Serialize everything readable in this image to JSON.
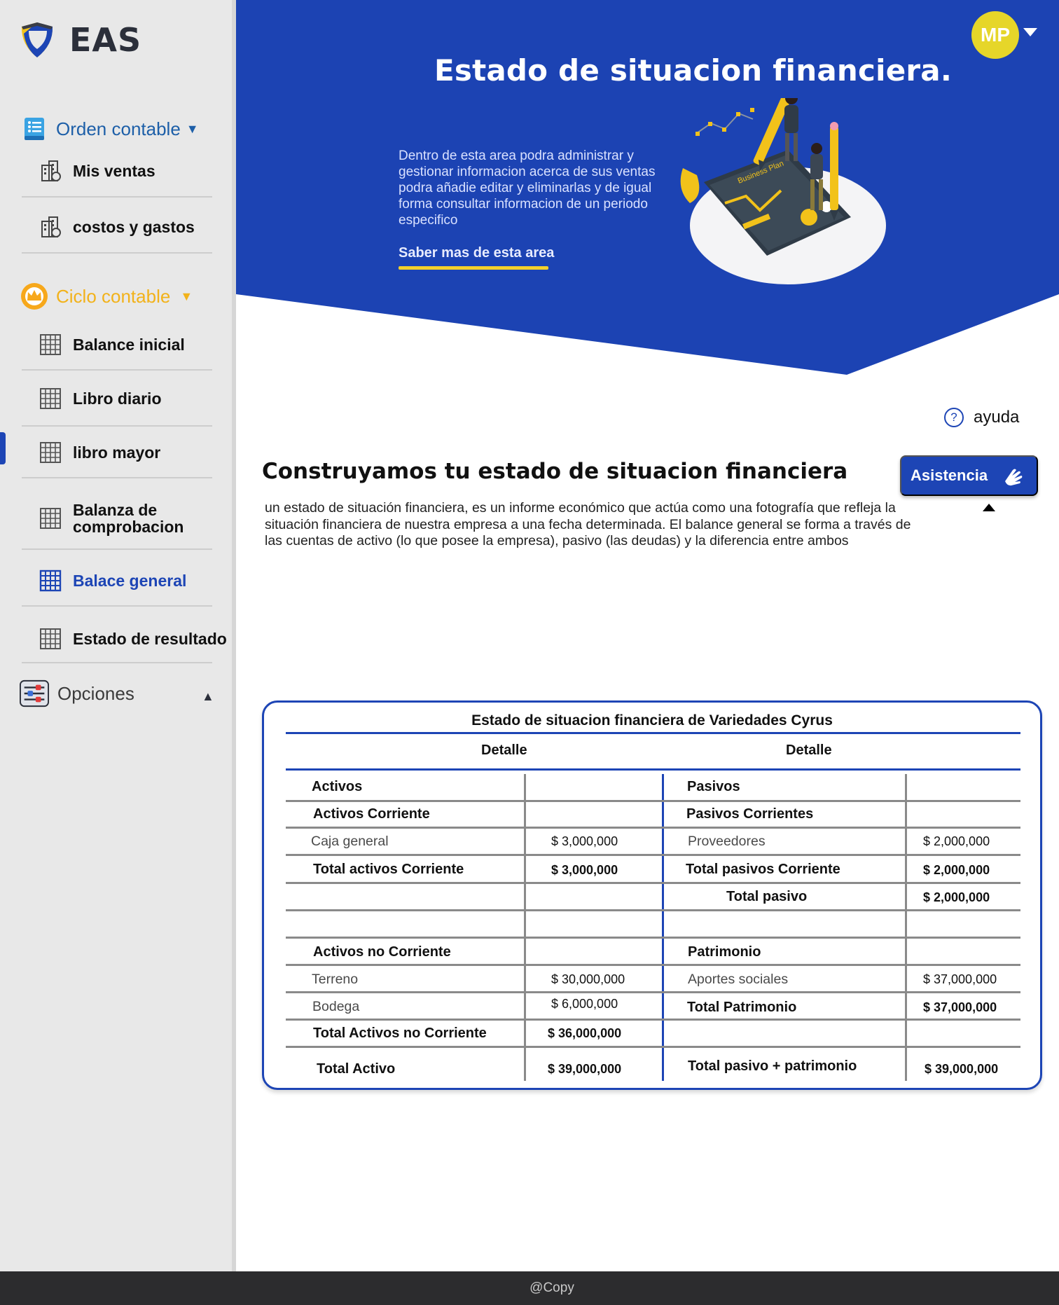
{
  "brand": {
    "name": "EAS",
    "logo_icon": "shield-logo-icon"
  },
  "sidebar": {
    "orden": {
      "label": "Orden contable",
      "icon": "list-document-icon",
      "color": "#1d5fa8"
    },
    "orden_items": [
      {
        "label": "Mis ventas",
        "icon": "building-icon"
      },
      {
        "label": "costos y gastos",
        "icon": "building-icon"
      }
    ],
    "ciclo": {
      "label": "Ciclo contable",
      "icon": "crown-icon",
      "color": "#f2b21a"
    },
    "ciclo_items": [
      {
        "label": "Balance inicial",
        "icon": "grid-icon"
      },
      {
        "label": "Libro diario",
        "icon": "grid-icon"
      },
      {
        "label": "libro mayor",
        "icon": "grid-icon"
      },
      {
        "label_line1": "Balanza de",
        "label_line2": "comprobacion",
        "icon": "grid-icon"
      },
      {
        "label": "Balace general",
        "icon": "grid-icon",
        "active": true
      },
      {
        "label": "Estado de resultado",
        "icon": "grid-icon"
      }
    ],
    "opciones": {
      "label": "Opciones",
      "icon": "sliders-icon"
    }
  },
  "banner": {
    "title": "Estado de situacion financiera.",
    "description": "Dentro de esta area podra administrar y gestionar informacion acerca de sus ventas podra añadie editar y eliminarlas y de igual forma consultar informacion de un periodo especifico",
    "link": "Saber mas de esta area",
    "illustration_text": "Business Plan",
    "bg_color": "#1c43b3"
  },
  "user": {
    "initials": "MP",
    "avatar_color": "#e6d629"
  },
  "help": {
    "label": "ayuda",
    "icon": "question-circle-icon"
  },
  "content": {
    "heading": "Construyamos tu estado de situacion financiera",
    "intro": "un estado de situación financiera, es un informe económico que actúa como una fotografía que refleja la situación financiera de nuestra empresa a una fecha determinada. El balance general se forma a través de las cuentas de activo (lo que posee la empresa), pasivo (las deudas) y la diferencia entre ambos",
    "assist_button": "Asistencia",
    "assist_icon": "hand-icon"
  },
  "statement": {
    "title": "Estado de situacion financiera de Variedades Cyrus",
    "left_header": "Detalle",
    "right_header": "Detalle",
    "activos": "Activos",
    "activos_corriente": "Activos Corriente",
    "caja_label": "Caja general",
    "caja_value": "$ 3,000,000",
    "total_activos_corriente_label": "Total activos Corriente",
    "total_activos_corriente_value": "$ 3,000,000",
    "activos_no_corriente": "Activos no Corriente",
    "terreno_label": "Terreno",
    "terreno_value": "$ 30,000,000",
    "bodega_label": "Bodega",
    "bodega_value": "$ 6,000,000",
    "total_activos_no_corriente_label": "Total Activos no Corriente",
    "total_activos_no_corriente_value": "$ 36,000,000",
    "total_activo_label": "Total Activo",
    "total_activo_value": "$ 39,000,000",
    "pasivos": "Pasivos",
    "pasivos_corrientes": "Pasivos Corrientes",
    "proveedores_label": "Proveedores",
    "proveedores_value": "$ 2,000,000",
    "total_pasivos_corriente_label": "Total pasivos Corriente",
    "total_pasivos_corriente_value": "$ 2,000,000",
    "total_pasivo_label": "Total pasivo",
    "total_pasivo_value": "$ 2,000,000",
    "patrimonio": "Patrimonio",
    "aportes_label": "Aportes sociales",
    "aportes_value": "$ 37,000,000",
    "total_patrimonio_label": "Total Patrimonio",
    "total_patrimonio_value": "$ 37,000,000",
    "total_pasivo_patrimonio_label": "Total pasivo + patrimonio",
    "total_pasivo_patrimonio_value": "$ 39,000,000"
  },
  "footer": {
    "text": "@Copy"
  }
}
